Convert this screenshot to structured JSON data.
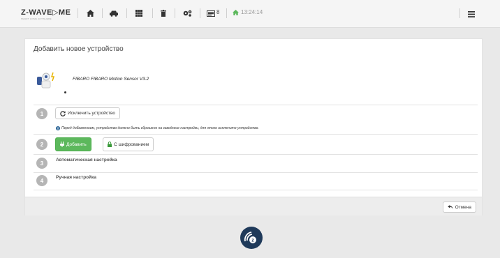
{
  "navbar": {
    "logo_text": "Z-WAVE▷ME",
    "logo_subtitle": "SMART HOME ANYWHERE",
    "icons": [
      "home-icon",
      "car-icon",
      "grid-icon",
      "trash-icon",
      "gears-icon"
    ],
    "counter_value": "8",
    "time": "13:24:14",
    "menu_icon": "hamburger-icon"
  },
  "panel": {
    "title": "Добавить новое устройство",
    "device_name": "FIBARO FIBARO Motion Sensor V3.2"
  },
  "steps": [
    {
      "number": "1",
      "button_label": "Исключить устройство",
      "hint": "Перед добавлением, устройство должно быть сброшено на заводские настройки, для этого исключите устройство."
    },
    {
      "number": "2",
      "add_label": "Добавить",
      "secure_label": "С шифрованием"
    },
    {
      "number": "3",
      "label": "Автоматическая настройка"
    },
    {
      "number": "4",
      "label": "Ручная настройка"
    }
  ],
  "footer": {
    "cancel_label": "Отмена"
  },
  "colors": {
    "accent_green": "#5cb85c",
    "brand_blue": "#1f3a5a"
  }
}
